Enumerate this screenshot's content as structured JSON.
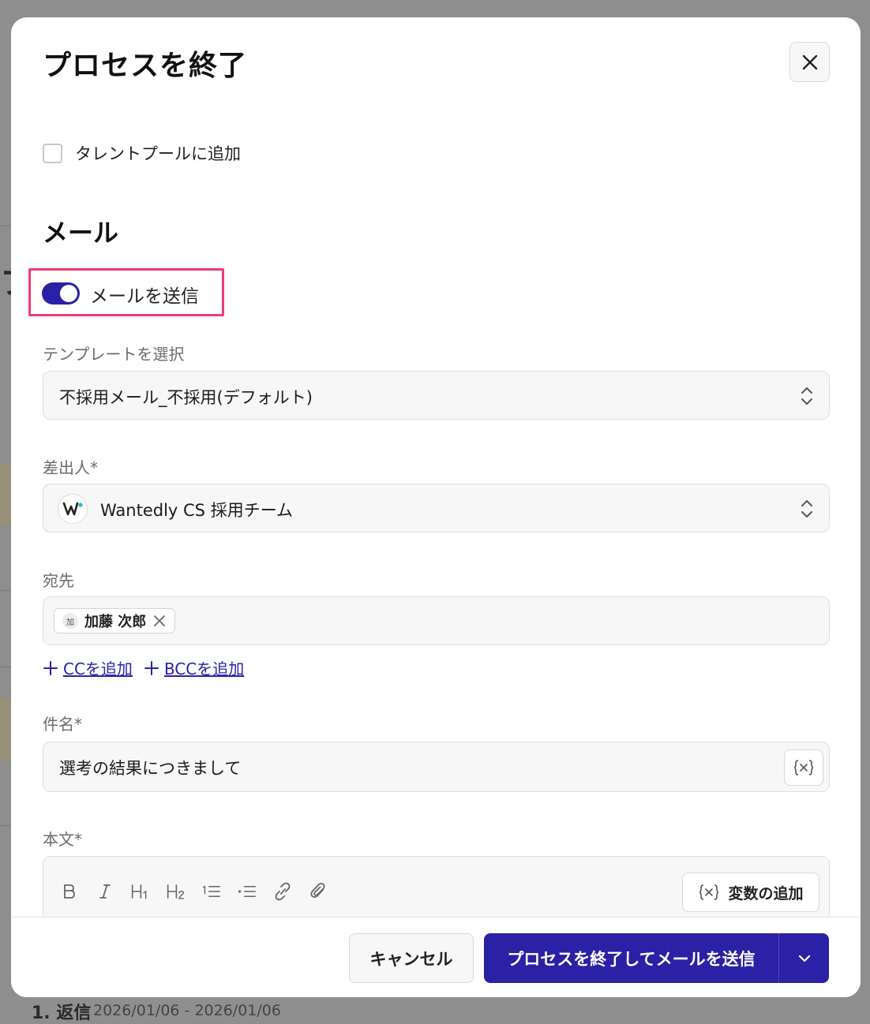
{
  "modal": {
    "title": "プロセスを終了",
    "close_icon": "close-icon"
  },
  "talent_pool": {
    "label": "タレントプールに追加",
    "checked": false
  },
  "mail_section": {
    "title": "メール",
    "toggle_label": "メールを送信",
    "toggle_on": true
  },
  "template": {
    "label": "テンプレートを選択",
    "value": "不採用メール_不採用(デフォルト)"
  },
  "sender": {
    "label": "差出人*",
    "value": "Wantedly CS 採用チーム"
  },
  "recipient": {
    "label": "宛先",
    "chip_avatar": "加",
    "chip_name": "加藤 次郎",
    "add_cc": "CCを追加",
    "add_bcc": "BCCを追加"
  },
  "subject": {
    "label": "件名*",
    "value": "選考の結果につきまして"
  },
  "body": {
    "label": "本文*",
    "toolbar": [
      "bold-icon",
      "italic-icon",
      "heading1-icon",
      "heading2-icon",
      "ordered-list-icon",
      "bullet-list-icon",
      "link-icon",
      "attachment-icon"
    ],
    "add_variable": "変数の追加"
  },
  "footer": {
    "cancel": "キャンセル",
    "submit": "プロセスを終了してメールを送信"
  },
  "background": {
    "bottom_item": "1. 返信",
    "bottom_dates": "2026/01/06 - 2026/01/06"
  },
  "colors": {
    "primary": "#2a21a6",
    "highlight": "#ee3b7b",
    "wantedly_accent": "#21bddb"
  }
}
